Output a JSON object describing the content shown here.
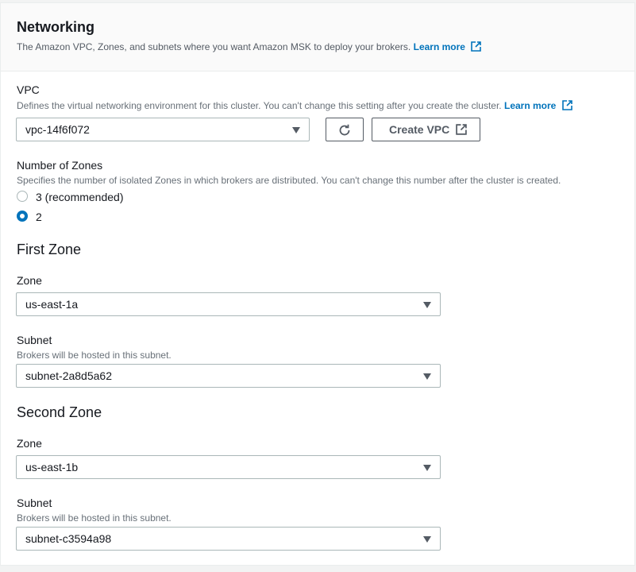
{
  "networking": {
    "title": "Networking",
    "description": "The Amazon VPC, Zones, and subnets where you want Amazon MSK to deploy your brokers.",
    "learn_more": "Learn more"
  },
  "vpc": {
    "label": "VPC",
    "description": "Defines the virtual networking environment for this cluster. You can't change this setting after you create the cluster.",
    "learn_more": "Learn more",
    "selected": "vpc-14f6f072",
    "create_button": "Create VPC"
  },
  "zones": {
    "label": "Number of Zones",
    "description": "Specifies the number of isolated Zones in which brokers are distributed. You can't change this number after the cluster is created.",
    "options": [
      {
        "label": "3 (recommended)",
        "checked": false
      },
      {
        "label": "2",
        "checked": true
      }
    ]
  },
  "first_zone": {
    "title": "First Zone",
    "zone_label": "Zone",
    "zone_value": "us-east-1a",
    "subnet_label": "Subnet",
    "subnet_desc": "Brokers will be hosted in this subnet.",
    "subnet_value": "subnet-2a8d5a62"
  },
  "second_zone": {
    "title": "Second Zone",
    "zone_label": "Zone",
    "zone_value": "us-east-1b",
    "subnet_label": "Subnet",
    "subnet_desc": "Brokers will be hosted in this subnet.",
    "subnet_value": "subnet-c3594a98"
  },
  "colors": {
    "link": "#0073bb",
    "radio_selected": "#0073bb",
    "text": "#16191f",
    "muted": "#687078"
  }
}
